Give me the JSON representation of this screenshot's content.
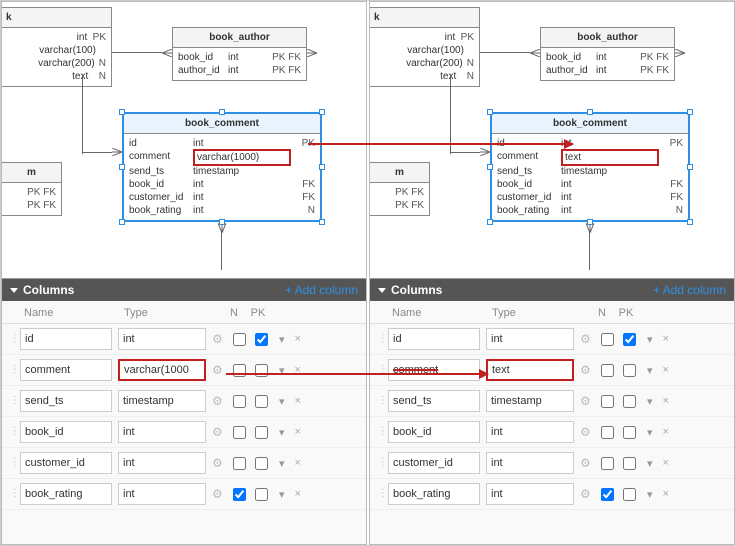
{
  "tables": {
    "book": {
      "title": "k",
      "rows": [
        {
          "name": "",
          "type": "int",
          "flags": "PK"
        },
        {
          "name": "",
          "type": "varchar(100)",
          "flags": ""
        },
        {
          "name": "",
          "type": "varchar(200)",
          "flags": "N"
        },
        {
          "name": "",
          "type": "text",
          "flags": "N"
        }
      ]
    },
    "book_author": {
      "title": "book_author",
      "rows": [
        {
          "name": "book_id",
          "type": "int",
          "flags": "PK FK"
        },
        {
          "name": "author_id",
          "type": "int",
          "flags": "PK FK"
        }
      ]
    },
    "book_comment_left": {
      "title": "book_comment",
      "rows": [
        {
          "name": "id",
          "type": "int",
          "flags": "PK"
        },
        {
          "name": "comment",
          "type": "varchar(1000)",
          "flags": ""
        },
        {
          "name": "send_ts",
          "type": "timestamp",
          "flags": ""
        },
        {
          "name": "book_id",
          "type": "int",
          "flags": "FK"
        },
        {
          "name": "customer_id",
          "type": "int",
          "flags": "FK"
        },
        {
          "name": "book_rating",
          "type": "int",
          "flags": "N"
        }
      ]
    },
    "book_comment_right": {
      "title": "book_comment",
      "rows": [
        {
          "name": "id",
          "type": "int",
          "flags": "PK"
        },
        {
          "name": "comment",
          "type": "text",
          "flags": ""
        },
        {
          "name": "send_ts",
          "type": "timestamp",
          "flags": ""
        },
        {
          "name": "book_id",
          "type": "int",
          "flags": "FK"
        },
        {
          "name": "customer_id",
          "type": "int",
          "flags": "FK"
        },
        {
          "name": "book_rating",
          "type": "int",
          "flags": "N"
        }
      ]
    },
    "em": {
      "title": "m",
      "rows": [
        {
          "name": "",
          "type": "",
          "flags": "PK FK"
        },
        {
          "name": "",
          "type": "",
          "flags": "PK FK"
        }
      ]
    }
  },
  "columnsPanel": {
    "title": "Columns",
    "add": "+ Add column",
    "headers": {
      "name": "Name",
      "type": "Type",
      "n": "N",
      "pk": "PK"
    },
    "rows_left": [
      {
        "name": "id",
        "type": "int",
        "n": false,
        "pk": true
      },
      {
        "name": "comment",
        "type": "varchar(1000",
        "n": false,
        "pk": false,
        "hiType": true
      },
      {
        "name": "send_ts",
        "type": "timestamp",
        "n": false,
        "pk": false
      },
      {
        "name": "book_id",
        "type": "int",
        "n": false,
        "pk": false
      },
      {
        "name": "customer_id",
        "type": "int",
        "n": false,
        "pk": false
      },
      {
        "name": "book_rating",
        "type": "int",
        "n": true,
        "pk": false
      }
    ],
    "rows_right": [
      {
        "name": "id",
        "type": "int",
        "n": false,
        "pk": true
      },
      {
        "name": "comment",
        "type": "text",
        "n": false,
        "pk": false,
        "hiType": true,
        "strikeName": true
      },
      {
        "name": "send_ts",
        "type": "timestamp",
        "n": false,
        "pk": false
      },
      {
        "name": "book_id",
        "type": "int",
        "n": false,
        "pk": false
      },
      {
        "name": "customer_id",
        "type": "int",
        "n": false,
        "pk": false
      },
      {
        "name": "book_rating",
        "type": "int",
        "n": true,
        "pk": false
      }
    ]
  }
}
